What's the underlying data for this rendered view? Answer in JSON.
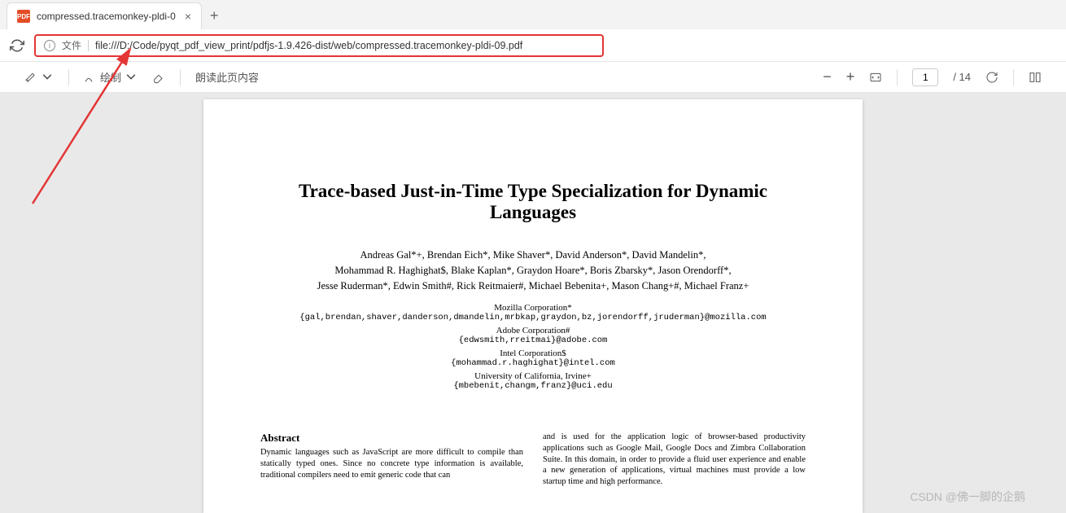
{
  "tab": {
    "icon_label": "PDF",
    "title": "compressed.tracemonkey-pldi-0"
  },
  "address": {
    "file_label": "文件",
    "url": "file:///D:/Code/pyqt_pdf_view_print/pdfjs-1.9.426-dist/web/compressed.tracemonkey-pldi-09.pdf"
  },
  "toolbar": {
    "draw_label": "绘制",
    "read_aloud": "朗读此页内容",
    "page_current": "1",
    "page_total": "/ 14"
  },
  "paper": {
    "title": "Trace-based Just-in-Time Type Specialization for Dynamic Languages",
    "authors_line1": "Andreas Gal*+, Brendan Eich*, Mike Shaver*, David Anderson*, David Mandelin*,",
    "authors_line2": "Mohammad R. Haghighat$, Blake Kaplan*, Graydon Hoare*, Boris Zbarsky*, Jason Orendorff*,",
    "authors_line3": "Jesse Ruderman*, Edwin Smith#, Rick Reitmaier#, Michael Bebenita+, Mason Chang+#, Michael Franz+",
    "affil": [
      {
        "name": "Mozilla Corporation*",
        "email": "{gal,brendan,shaver,danderson,dmandelin,mrbkap,graydon,bz,jorendorff,jruderman}@mozilla.com"
      },
      {
        "name": "Adobe Corporation#",
        "email": "{edwsmith,rreitmai}@adobe.com"
      },
      {
        "name": "Intel Corporation$",
        "email": "{mohammad.r.haghighat}@intel.com"
      },
      {
        "name": "University of California, Irvine+",
        "email": "{mbebenit,changm,franz}@uci.edu"
      }
    ],
    "abstract_heading": "Abstract",
    "abstract_body": "Dynamic languages such as JavaScript are more difficult to compile than statically typed ones. Since no concrete type information is available, traditional compilers need to emit generic code that can",
    "col2_body": "and is used for the application logic of browser-based productivity applications such as Google Mail, Google Docs and Zimbra Collaboration Suite. In this domain, in order to provide a fluid user experience and enable a new generation of applications, virtual machines must provide a low startup time and high performance."
  },
  "watermark": "CSDN @佛一脚的企鹅"
}
